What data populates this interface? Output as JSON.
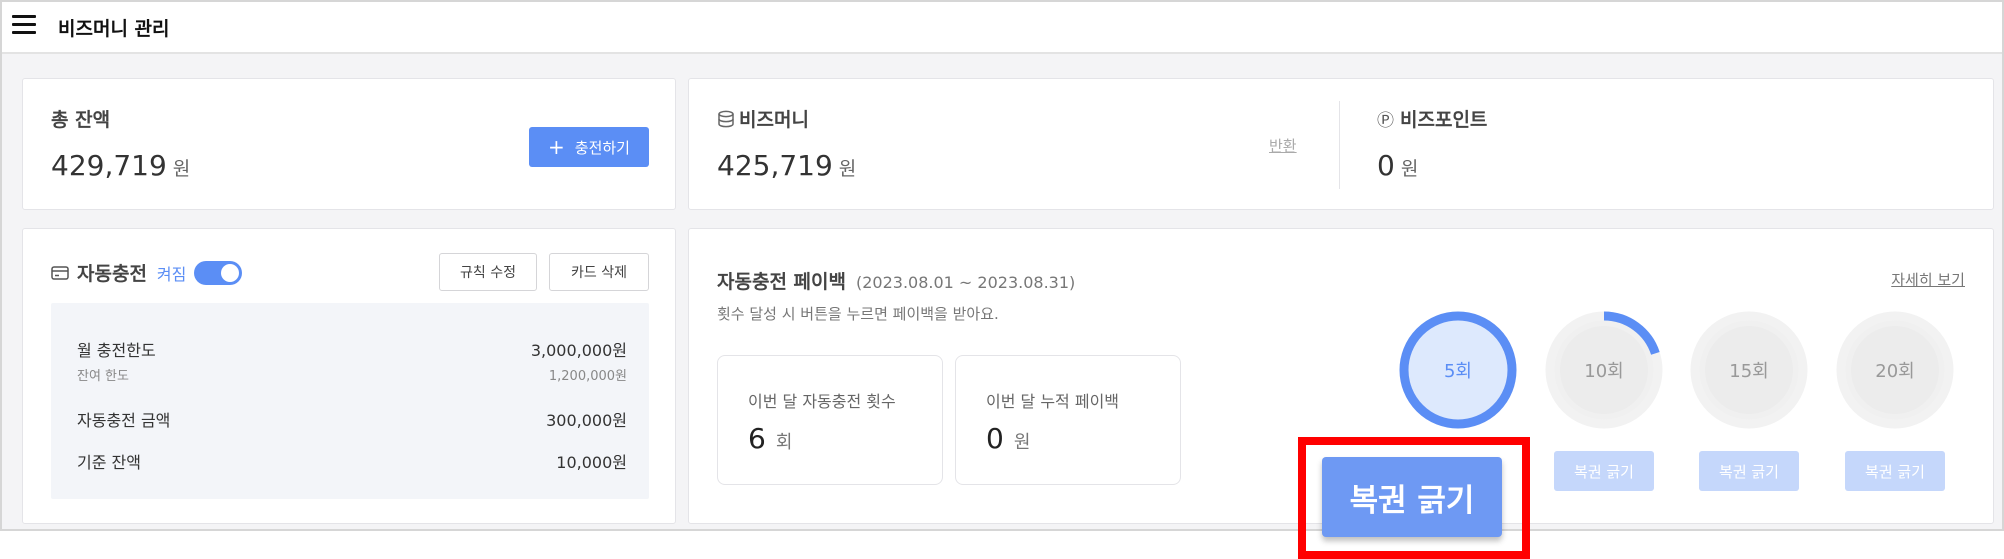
{
  "header": {
    "title": "비즈머니 관리"
  },
  "total": {
    "label": "총 잔액",
    "amount": "429,719",
    "unit": "원",
    "charge_button": "충전하기",
    "charge_icon": "plus-icon"
  },
  "bizmoney": {
    "icon": "database-icon",
    "label": "비즈머니",
    "amount": "425,719",
    "unit": "원",
    "refund_link": "반환"
  },
  "bizpoint": {
    "icon": "p-circle-icon",
    "symbol": "Ⓟ",
    "label": "비즈포인트",
    "amount": "0",
    "unit": "원"
  },
  "autocharge": {
    "icon": "card-icon",
    "label": "자동충전",
    "status": "켜짐",
    "toggle_on": true,
    "edit_rule_button": "규칙 수정",
    "delete_card_button": "카드 삭제",
    "monthly_limit_label": "월 충전한도",
    "monthly_limit_value": "3,000,000원",
    "remaining_limit_label": "잔여 한도",
    "remaining_limit_value": "1,200,000원",
    "charge_amount_label": "자동충전 금액",
    "charge_amount_value": "300,000원",
    "base_balance_label": "기준 잔액",
    "base_balance_value": "10,000원"
  },
  "payback": {
    "title": "자동충전 페이백",
    "period": "(2023.08.01 ~ 2023.08.31)",
    "description": "횟수 달성 시 버튼을 누르면 페이백을 받아요.",
    "details_link": "자세히 보기",
    "count_label": "이번 달 자동충전 횟수",
    "count_value": "6",
    "count_unit": "회",
    "cumulative_label": "이번 달 누적 페이백",
    "cumulative_value": "0",
    "cumulative_unit": "원",
    "milestones": [
      {
        "label": "5회",
        "progress": 1.0,
        "button": "복권 긁기"
      },
      {
        "label": "10회",
        "progress": 0.2,
        "button": "복권 긁기"
      },
      {
        "label": "15회",
        "progress": 0.0,
        "button": "복권 긁기"
      },
      {
        "label": "20회",
        "progress": 0.0,
        "button": "복권 긁기"
      }
    ]
  },
  "colors": {
    "accent": "#5b8ef5",
    "pale_accent": "#c5d7fb",
    "highlight": "#ff0000",
    "ring_track": "#f0f0f0"
  }
}
